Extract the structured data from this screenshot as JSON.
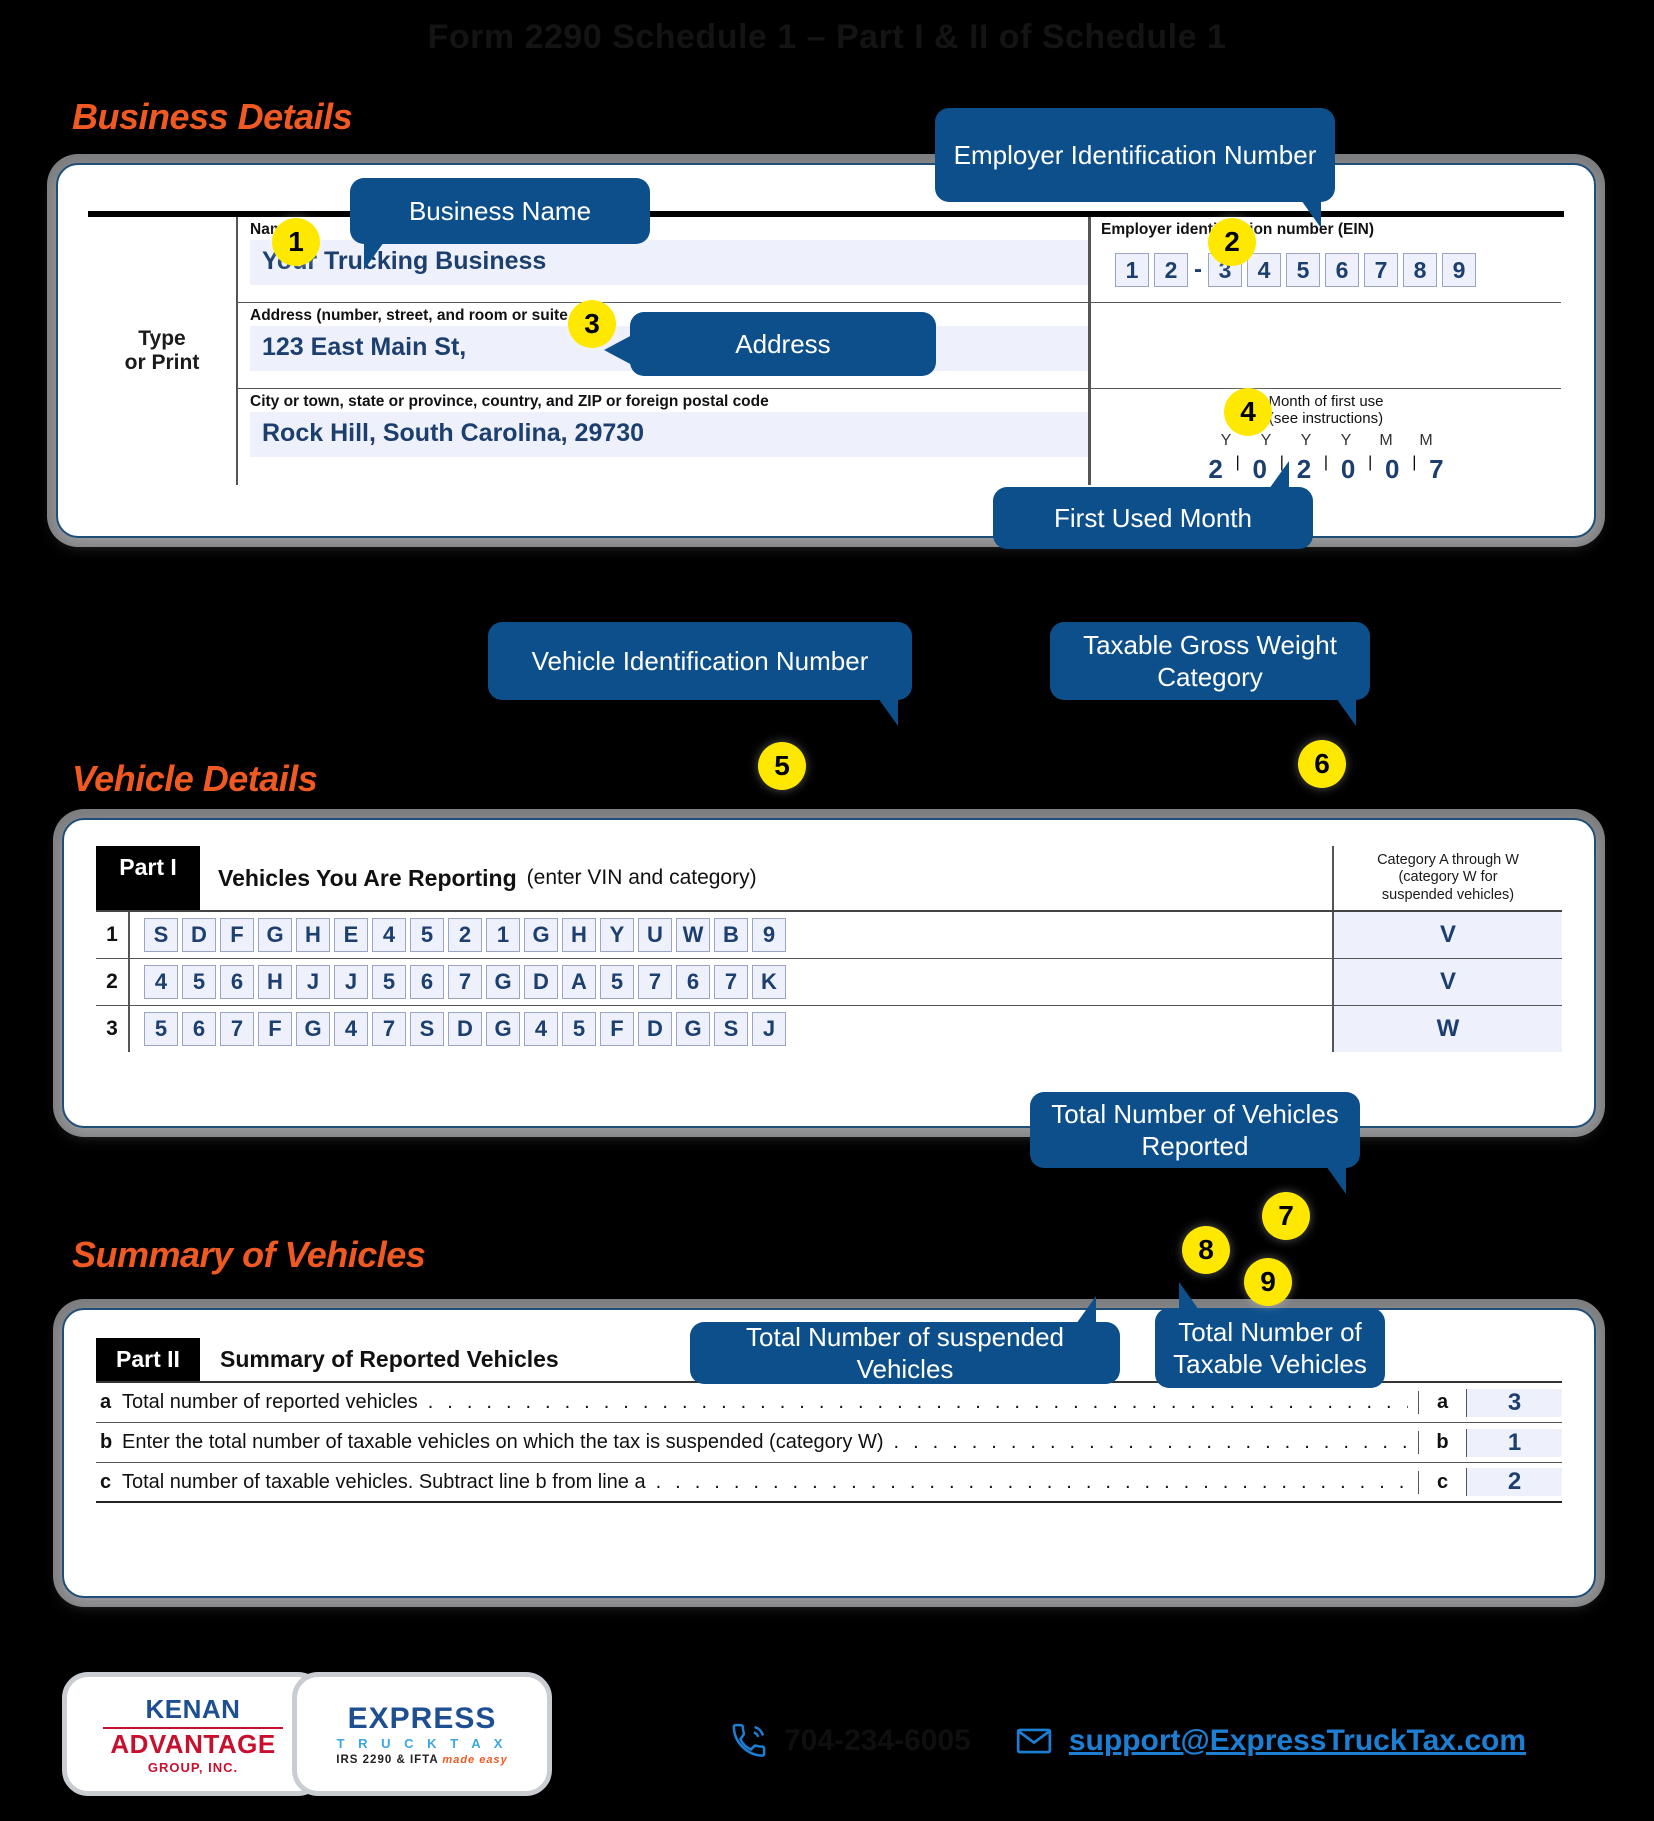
{
  "document": {
    "title": "Form 2290 Schedule 1 – Part I & II of Schedule 1"
  },
  "sections": {
    "business": "Business Details",
    "vehicle": "Vehicle Details",
    "summary": "Summary of Vehicles"
  },
  "business_form": {
    "type_or_print": "Type\nor Print",
    "type_or_print_line1": "Type",
    "type_or_print_line2": "or Print",
    "name_label": "Name",
    "name_value": "Your Trucking Business",
    "address_label": "Address (number, street, and room or suite no.)",
    "address_value": "123 East Main St,",
    "city_label": "City or town, state or province, country, and ZIP or foreign postal code",
    "city_value": "Rock Hill, South Carolina, 29730",
    "ein_label": "Employer identification number (EIN)",
    "ein_digits": [
      "1",
      "2",
      "-",
      "3",
      "4",
      "5",
      "6",
      "7",
      "8",
      "9"
    ],
    "month_label_line1": "Month of first use",
    "month_label_line2": "(see instructions)",
    "month_headers": [
      "Y",
      "Y",
      "Y",
      "Y",
      "M",
      "M"
    ],
    "month_digits": [
      "2",
      "0",
      "2",
      "0",
      "0",
      "7"
    ]
  },
  "vehicle_form": {
    "part_tag": "Part I",
    "title": "Vehicles You Are Reporting",
    "subtitle": "(enter VIN and category)",
    "category_header_line1": "Category A through W",
    "category_header_line2": "(category W for",
    "category_header_line3": "suspended vehicles)",
    "rows": [
      {
        "no": "1",
        "vin": "SDFGHE4521GHYUWB9",
        "category": "V"
      },
      {
        "no": "2",
        "vin": "456HJJ567GDA5767K",
        "category": "V"
      },
      {
        "no": "3",
        "vin": "567FG47SDG45FDGSJ",
        "category": "W"
      }
    ]
  },
  "summary_form": {
    "part_tag": "Part II",
    "title": "Summary of Reported Vehicles",
    "lines": [
      {
        "letter": "a",
        "text": "Total number of reported vehicles",
        "key": "a",
        "value": "3"
      },
      {
        "letter": "b",
        "text": "Enter the total number of taxable vehicles on which the tax is suspended (category W)",
        "key": "b",
        "value": "1"
      },
      {
        "letter": "c",
        "text": "Total number of taxable vehicles. Subtract line b from line a",
        "key": "c",
        "value": "2"
      }
    ]
  },
  "callouts": [
    {
      "n": "1",
      "text": "Business Name"
    },
    {
      "n": "2",
      "text": "Employer Identification Number"
    },
    {
      "n": "3",
      "text": "Address"
    },
    {
      "n": "4",
      "text": "First Used Month"
    },
    {
      "n": "5",
      "text": "Vehicle Identification Number"
    },
    {
      "n": "6",
      "text": "Taxable Gross Weight Category"
    },
    {
      "n": "7",
      "text": "Total Number of Vehicles Reported"
    },
    {
      "n": "8",
      "text": "Total Number of suspended Vehicles"
    },
    {
      "n": "9",
      "text": "Total Number of Taxable Vehicles"
    }
  ],
  "footer": {
    "kenan_logo_line1": "KENAN",
    "kenan_logo_line2": "ADVANTAGE",
    "kenan_logo_line3": "GROUP, INC.",
    "express_logo_line1": "EXPRESS",
    "express_logo_line2": "T R U C K   T A X",
    "express_logo_line3": "IRS 2290 & IFTA",
    "express_logo_tag": "made easy",
    "phone": "704-234-6005",
    "email": "support@ExpressTruckTax.com",
    "phone_icon": "phone-icon",
    "email_icon": "envelope-icon"
  },
  "colors": {
    "accent_orange": "#F05A22",
    "callout_blue": "#0d4f8b",
    "marker_yellow": "#FFE800",
    "form_value_blue": "#1c3f6e",
    "link_blue": "#1C7FD4"
  }
}
